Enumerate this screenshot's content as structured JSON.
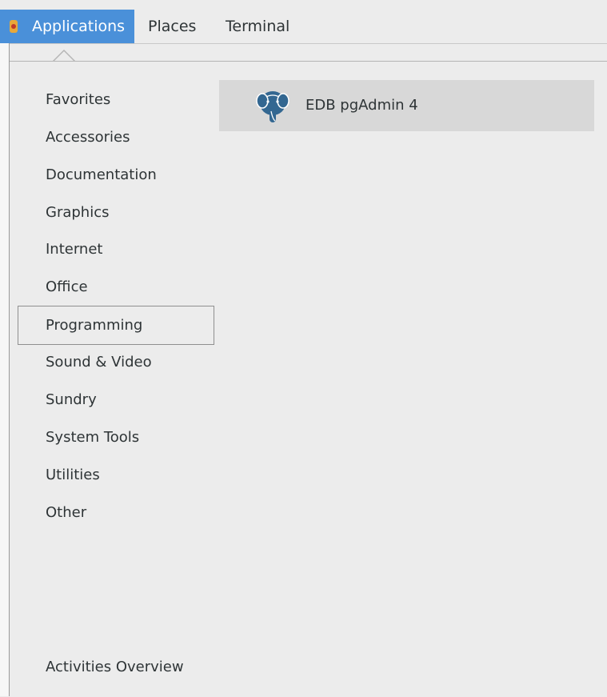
{
  "topbar": {
    "applications_label": "Applications",
    "places_label": "Places",
    "terminal_label": "Terminal"
  },
  "menu": {
    "categories": [
      "Favorites",
      "Accessories",
      "Documentation",
      "Graphics",
      "Internet",
      "Office",
      "Programming",
      "Sound & Video",
      "Sundry",
      "System Tools",
      "Utilities",
      "Other"
    ],
    "selected_category": "Programming",
    "apps": [
      {
        "label": "EDB pgAdmin 4",
        "icon": "postgresql-elephant-icon"
      }
    ],
    "activities_label": "Activities Overview"
  },
  "colors": {
    "accent": "#4a90d9",
    "background": "#ececec",
    "tile_highlight": "#d8d8d8",
    "icon_blue": "#336791"
  }
}
